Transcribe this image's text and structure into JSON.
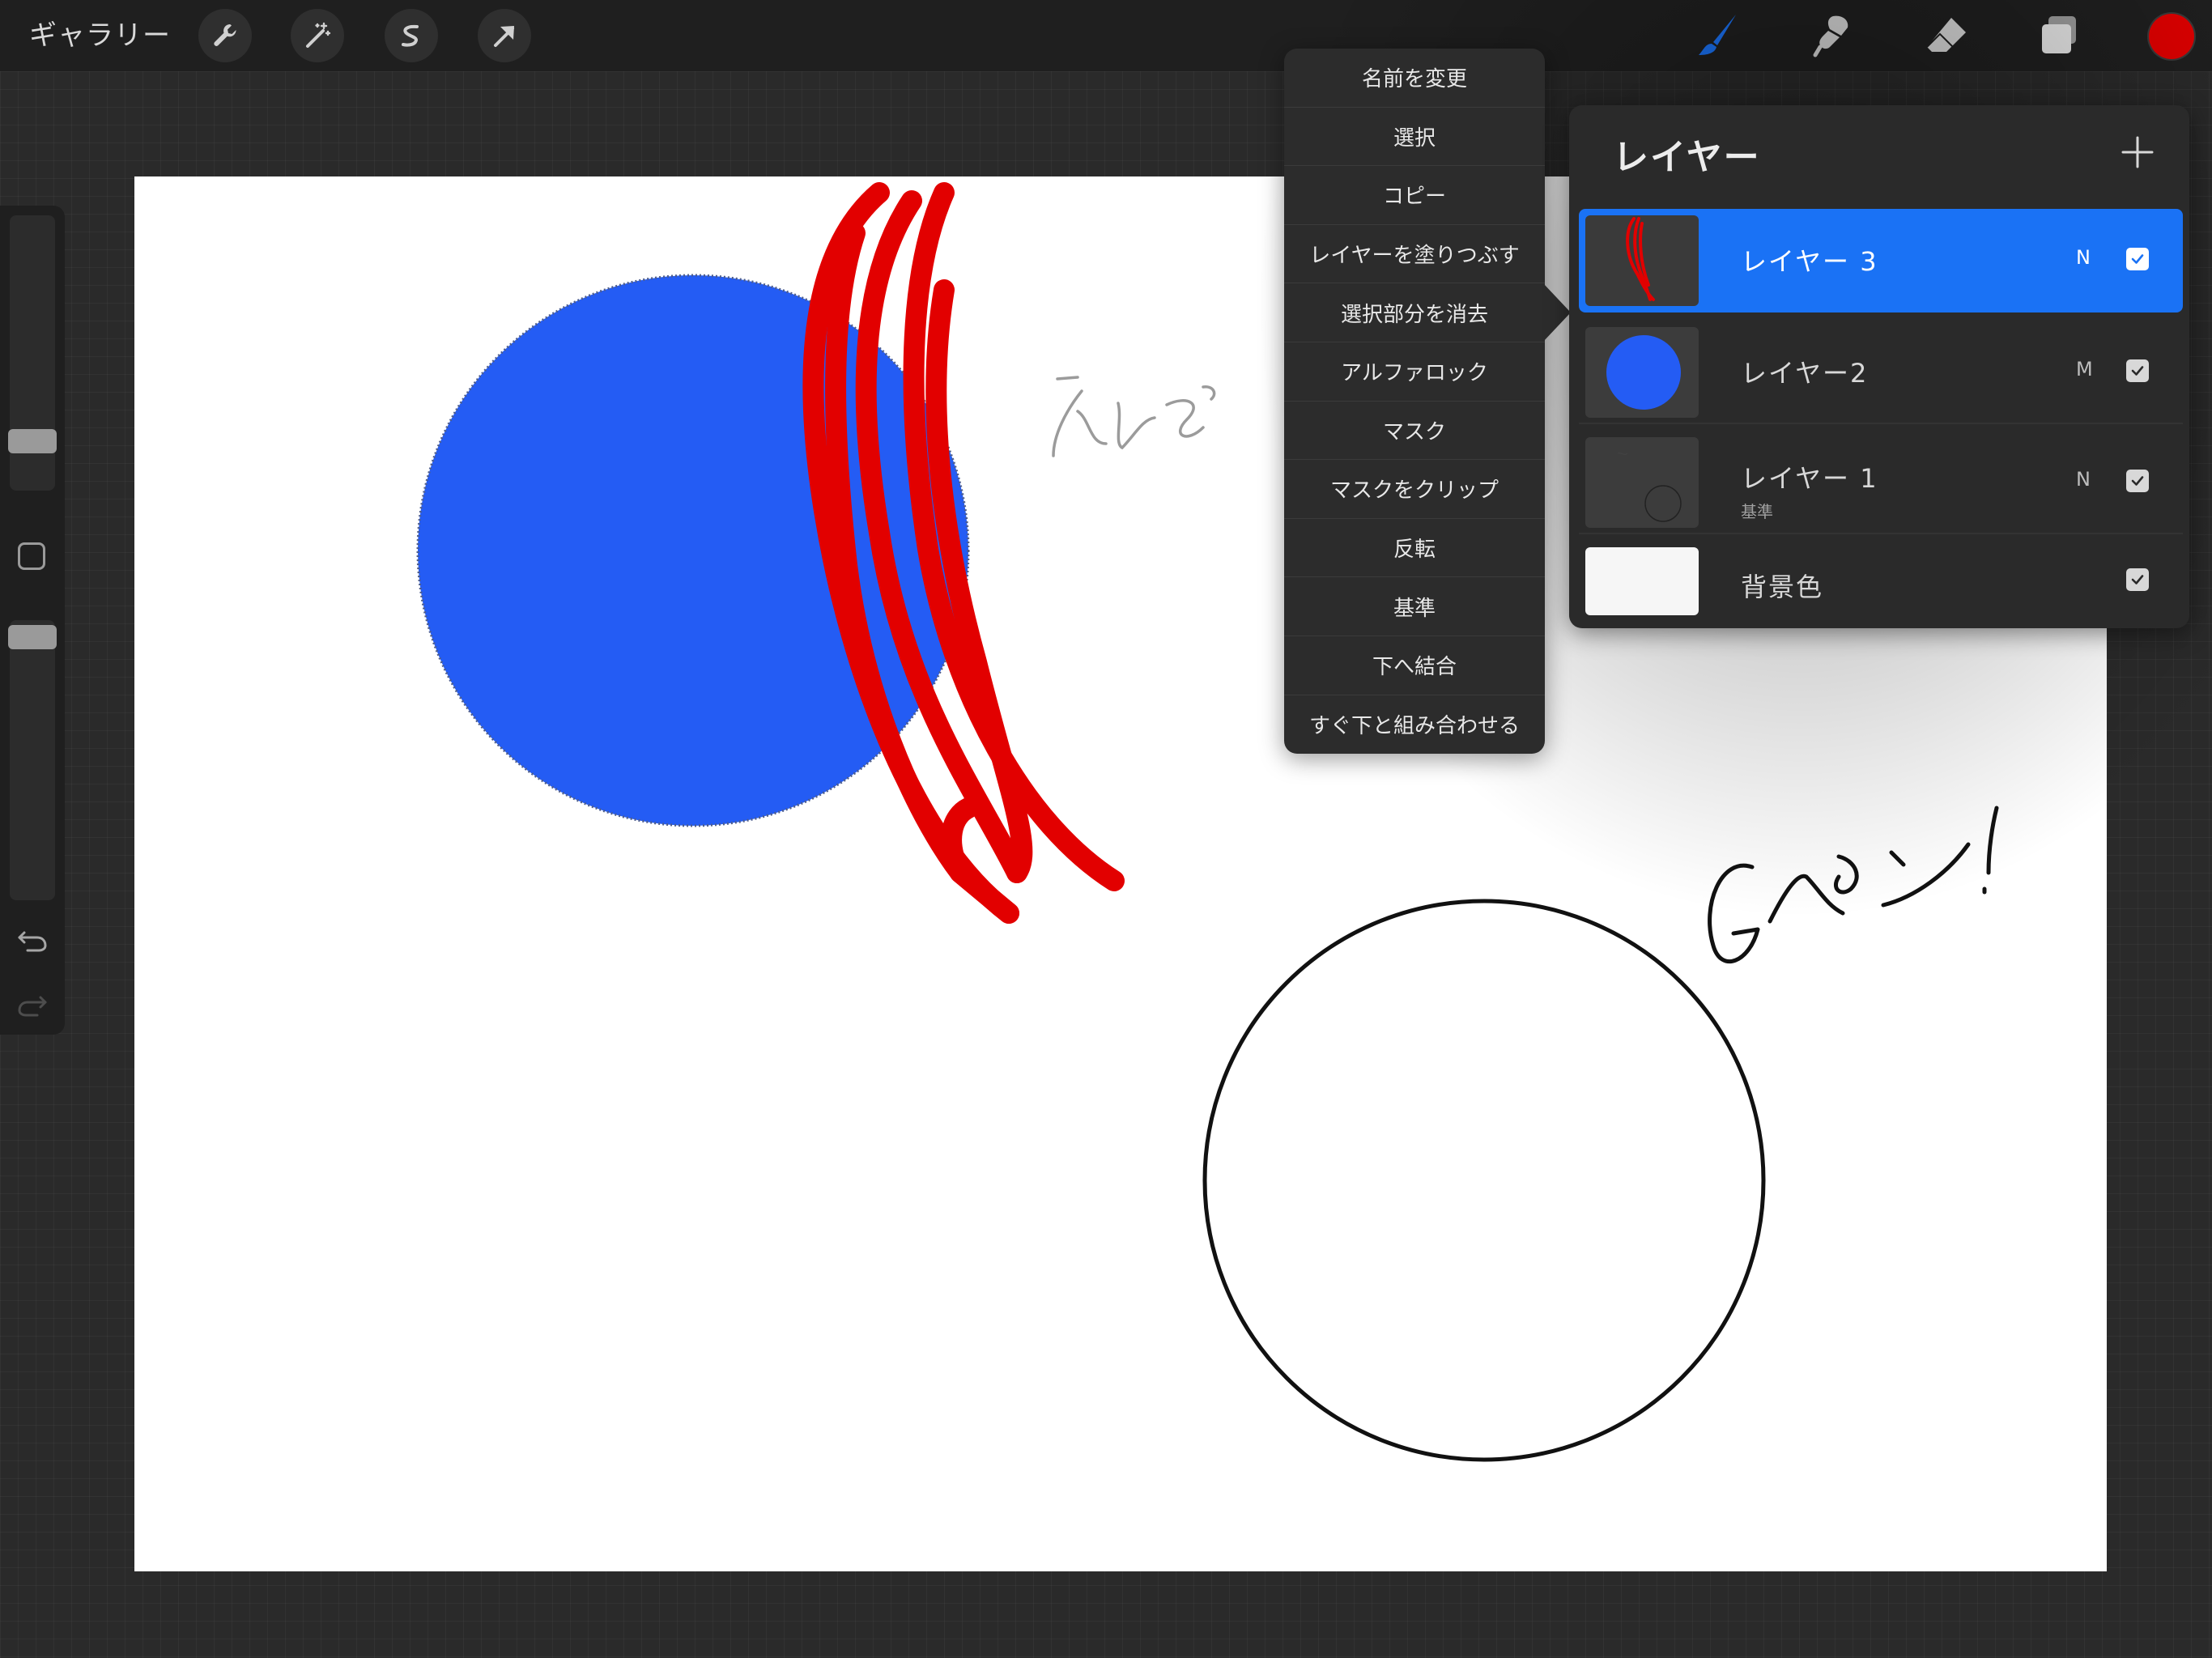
{
  "topbar": {
    "gallery_label": "ギャラリー",
    "left_tools": [
      "wrench-icon",
      "magic-wand-icon",
      "selection-icon",
      "transform-arrow-icon"
    ],
    "right_tools": [
      "brush-icon",
      "smudge-icon",
      "eraser-icon",
      "layers-icon"
    ],
    "current_color": "#e00000"
  },
  "sidebar": {
    "brush_size_label": "",
    "opacity_label": "",
    "undo_icon": "undo-icon",
    "redo_icon": "redo-icon"
  },
  "context_menu": {
    "items": [
      "名前を変更",
      "選択",
      "コピー",
      "レイヤーを塗りつぶす",
      "選択部分を消去",
      "アルファロック",
      "マスク",
      "マスクをクリップ",
      "反転",
      "基準",
      "下へ結合",
      "すぐ下と組み合わせる"
    ]
  },
  "layers_panel": {
    "title": "レイヤー",
    "add_icon": "plus-icon",
    "layers": [
      {
        "name": "レイヤー 3",
        "blend": "N",
        "visible": true,
        "selected": true,
        "sub": ""
      },
      {
        "name": "レイヤー2",
        "blend": "M",
        "visible": true,
        "selected": false,
        "sub": ""
      },
      {
        "name": "レイヤー 1",
        "blend": "N",
        "visible": true,
        "selected": false,
        "sub": "基準"
      },
      {
        "name": "背景色",
        "blend": "",
        "visible": true,
        "selected": false,
        "sub": ""
      }
    ]
  },
  "canvas_content": {
    "handwriting_1": "えんぴつ",
    "handwriting_2": "Gペン!",
    "colors": {
      "blue_circle": "#245cf4",
      "red_strokes": "#e20000",
      "outline": "#111111"
    }
  },
  "colors": {
    "accent_blue": "#1a72f5",
    "toolbar_bg": "#1f1f1f",
    "menu_bg": "#2c2c2c"
  }
}
